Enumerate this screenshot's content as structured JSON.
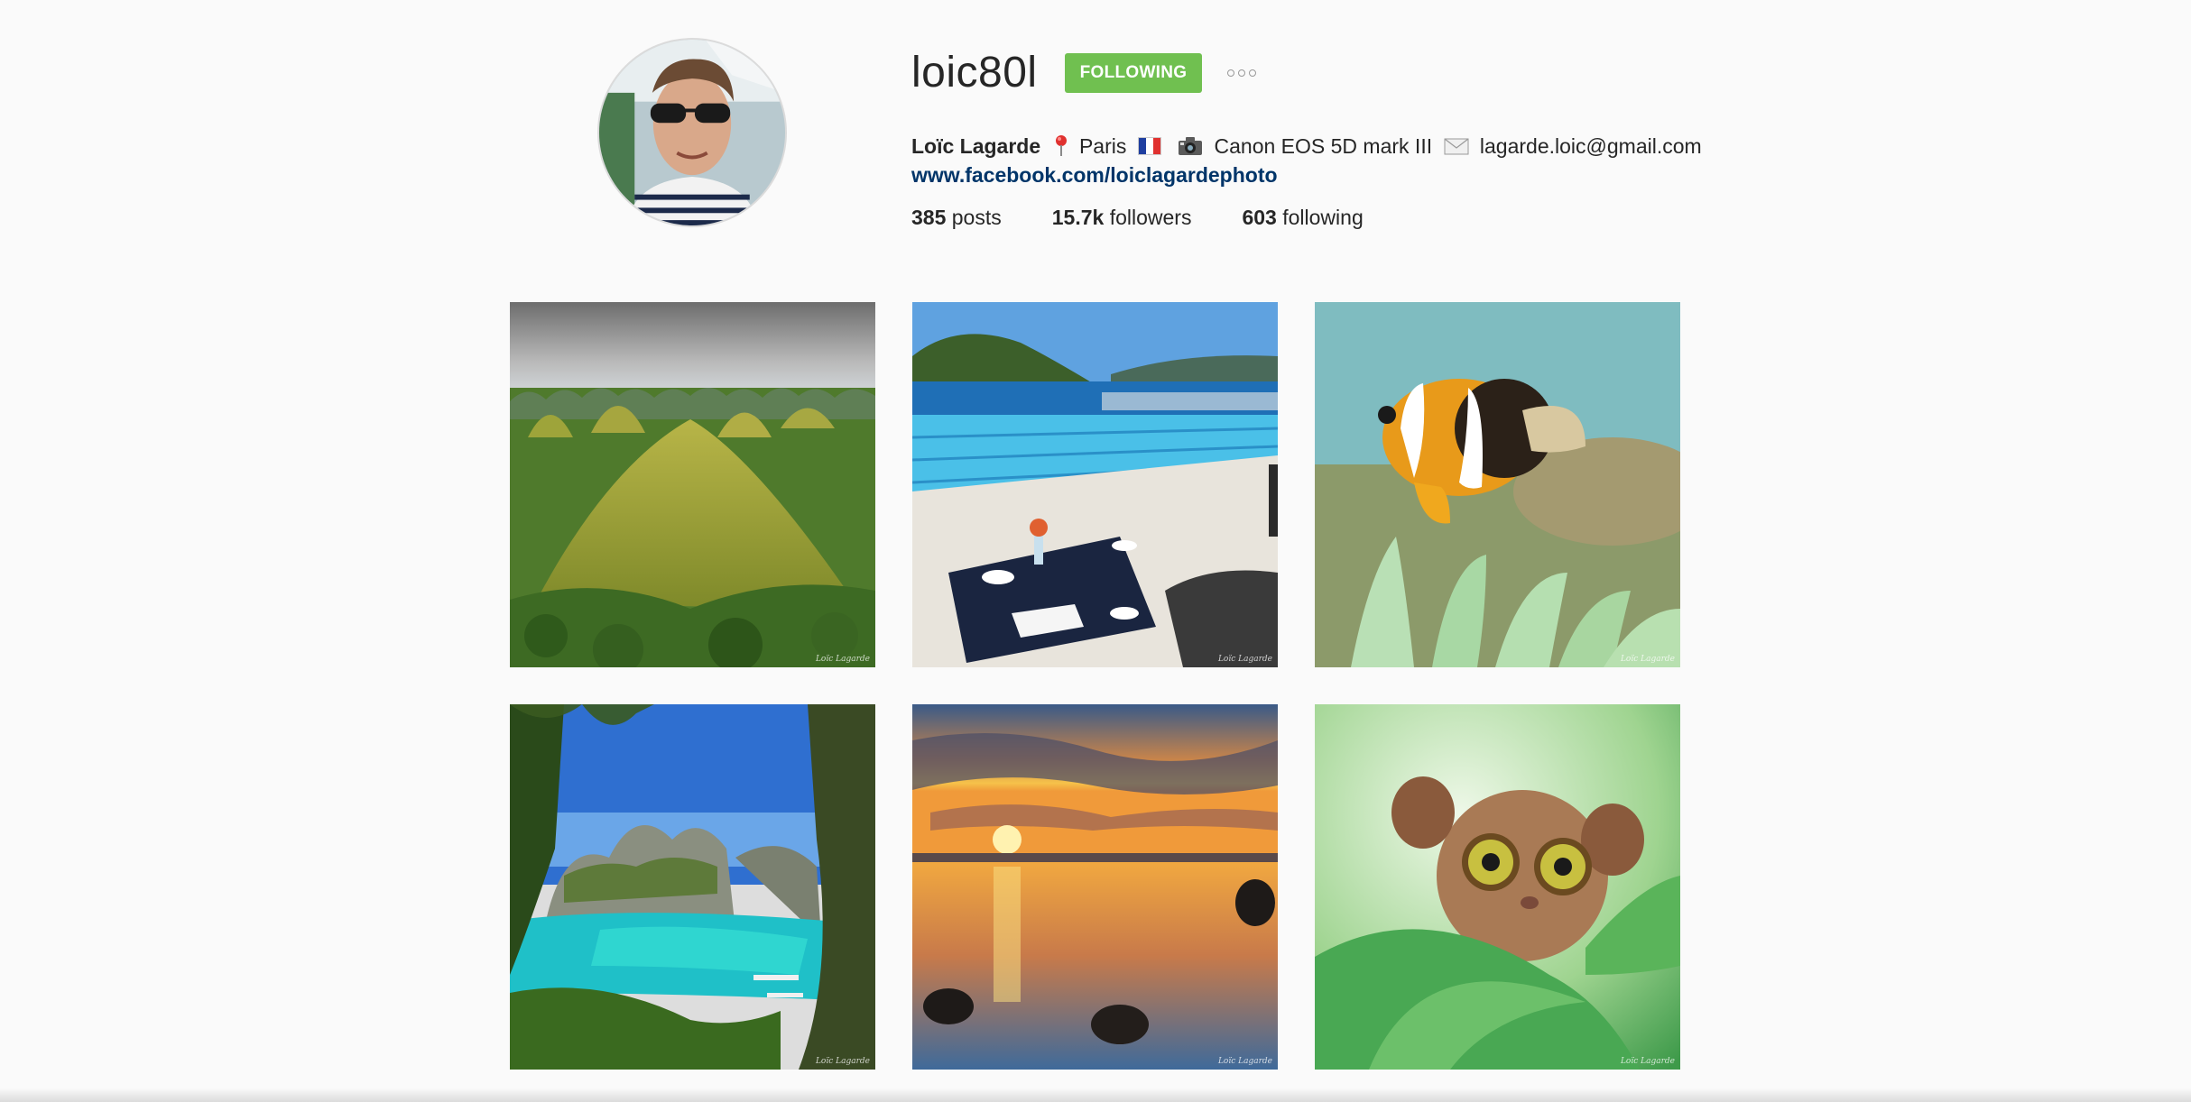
{
  "profile": {
    "username": "loic80l",
    "follow_button_label": "FOLLOWING",
    "options_icon": "more-options-icon",
    "full_name": "Loïc Lagarde",
    "bio_location": "Paris",
    "bio_camera": "Canon EOS 5D mark III",
    "bio_email": "lagarde.loic@gmail.com",
    "website": "www.facebook.com/loiclagardephoto",
    "stats": {
      "posts_count": "385",
      "posts_label": "posts",
      "followers_count": "15.7k",
      "followers_label": "followers",
      "following_count": "603",
      "following_label": "following"
    }
  },
  "posts": [
    {
      "subject": "chocolate-hills",
      "watermark": "Loïc Lagarde"
    },
    {
      "subject": "infinity-pool-breakfast",
      "watermark": "Loïc Lagarde"
    },
    {
      "subject": "clownfish-anemone",
      "watermark": "Loïc Lagarde"
    },
    {
      "subject": "lagoon-cliffs",
      "watermark": "Loïc Lagarde"
    },
    {
      "subject": "sunset-reflection",
      "watermark": "Loïc Lagarde"
    },
    {
      "subject": "tarsier",
      "watermark": "Loïc Lagarde"
    }
  ],
  "colors": {
    "background": "#fafafa",
    "follow_green": "#70c050",
    "link_blue": "#003569"
  }
}
